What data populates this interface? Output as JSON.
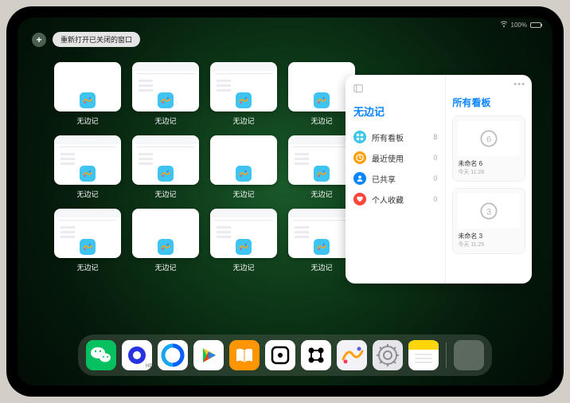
{
  "status": {
    "battery_text": "100%"
  },
  "topbar": {
    "plus": "+",
    "reopen_label": "重新打开已关闭的窗口"
  },
  "app_name": "无边记",
  "tiles": {
    "label": "无边记",
    "items": [
      {
        "detailed": false
      },
      {
        "detailed": true
      },
      {
        "detailed": true
      },
      {
        "detailed": false
      },
      {
        "detailed": true
      },
      {
        "detailed": true
      },
      {
        "detailed": false
      },
      {
        "detailed": true
      },
      {
        "detailed": true
      },
      {
        "detailed": false
      },
      {
        "detailed": true
      },
      {
        "detailed": true
      }
    ]
  },
  "panel": {
    "left_title": "无边记",
    "right_title": "所有看板",
    "categories": [
      {
        "icon": "grid",
        "color": "#38c8ea",
        "label": "所有看板",
        "count": 8
      },
      {
        "icon": "clock",
        "color": "#ff9f0a",
        "label": "最近使用",
        "count": 0
      },
      {
        "icon": "person",
        "color": "#0a84ff",
        "label": "已共享",
        "count": 0
      },
      {
        "icon": "heart",
        "color": "#ff453a",
        "label": "个人收藏",
        "count": 0
      }
    ],
    "boards": [
      {
        "digit": "6",
        "name": "未命名 6",
        "time": "今天 11:26"
      },
      {
        "digit": "3",
        "name": "未命名 3",
        "time": "今天 11:25"
      }
    ]
  },
  "dock": [
    {
      "name": "wechat",
      "bg": "#07c160"
    },
    {
      "name": "quark",
      "bg": "#ffffff"
    },
    {
      "name": "qqbrowser",
      "bg": "#ffffff"
    },
    {
      "name": "play",
      "bg": "#ffffff"
    },
    {
      "name": "books",
      "bg": "#ff9500"
    },
    {
      "name": "dice",
      "bg": "#ffffff"
    },
    {
      "name": "nodes",
      "bg": "#ffffff"
    },
    {
      "name": "freeform",
      "bg": "#3fc3f0"
    },
    {
      "name": "settings",
      "bg": "#8e8e93"
    },
    {
      "name": "notes",
      "bg": "#ffe46b"
    }
  ],
  "dock_recent": {
    "name": "app-library"
  }
}
